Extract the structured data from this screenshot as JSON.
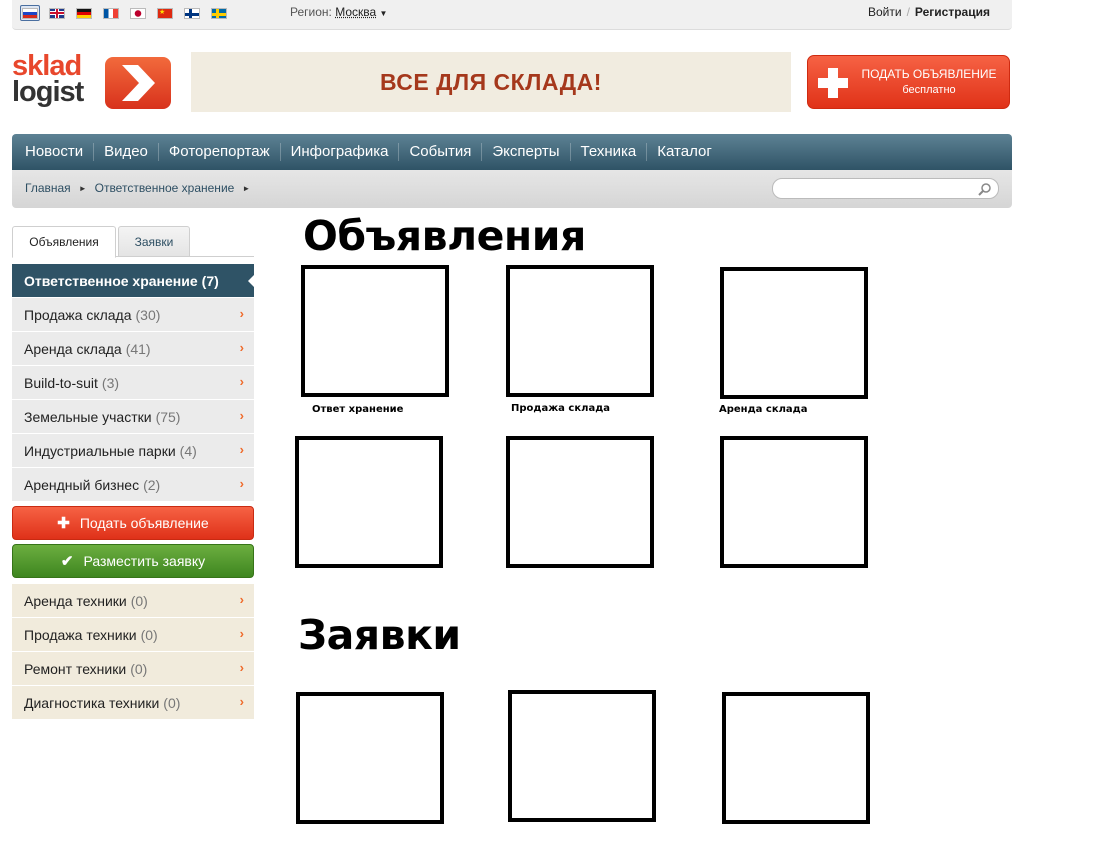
{
  "topbar": {
    "flags": [
      "ru",
      "gb",
      "de",
      "fr",
      "jp",
      "cn",
      "fi",
      "se"
    ],
    "region_label": "Регион:",
    "region_city": "Москва",
    "login": "Войти",
    "separator": "/",
    "register": "Регистрация"
  },
  "header": {
    "logo_line1": "sklad",
    "logo_line2": "logist",
    "banner": "ВСЕ ДЛЯ СКЛАДА!",
    "post_ad_title": "ПОДАТЬ ОБЪЯВЛЕНИЕ",
    "post_ad_subtitle": "бесплатно"
  },
  "nav": {
    "items": [
      "Новости",
      "Видео",
      "Фоторепортаж",
      "Инфографика",
      "События",
      "Эксперты",
      "Техника",
      "Каталог"
    ]
  },
  "breadcrumb": {
    "items": [
      "Главная",
      "Ответственное хранение"
    ]
  },
  "search": {
    "placeholder": ""
  },
  "sidebar": {
    "tabs": [
      "Объявления",
      "Заявки"
    ],
    "categories": [
      {
        "label": "Ответственное хранение",
        "count": "(7)"
      },
      {
        "label": "Продажа склада",
        "count": "(30)"
      },
      {
        "label": "Аренда склада",
        "count": "(41)"
      },
      {
        "label": "Build-to-suit",
        "count": "(3)"
      },
      {
        "label": "Земельные участки",
        "count": "(75)"
      },
      {
        "label": "Индустриальные парки",
        "count": "(4)"
      },
      {
        "label": "Арендный бизнес",
        "count": "(2)"
      }
    ],
    "btn_post": "Подать объявление",
    "btn_request": "Разместить заявку",
    "tech": [
      {
        "label": "Аренда техники",
        "count": "(0)"
      },
      {
        "label": "Продажа техники",
        "count": "(0)"
      },
      {
        "label": "Ремонт техники",
        "count": "(0)"
      },
      {
        "label": "Диагностика техники",
        "count": "(0)"
      }
    ]
  },
  "main": {
    "ads_heading": "Объявления",
    "ads_captions": [
      "Ответ хранение",
      "Продажа склада",
      "Аренда склада"
    ],
    "requests_heading": "Заявки"
  },
  "colors": {
    "accent_orange": "#e8472c",
    "nav_dark": "#2f5366",
    "button_red": "#e03218",
    "button_green": "#4a9228",
    "banner_text": "#a5381c"
  }
}
